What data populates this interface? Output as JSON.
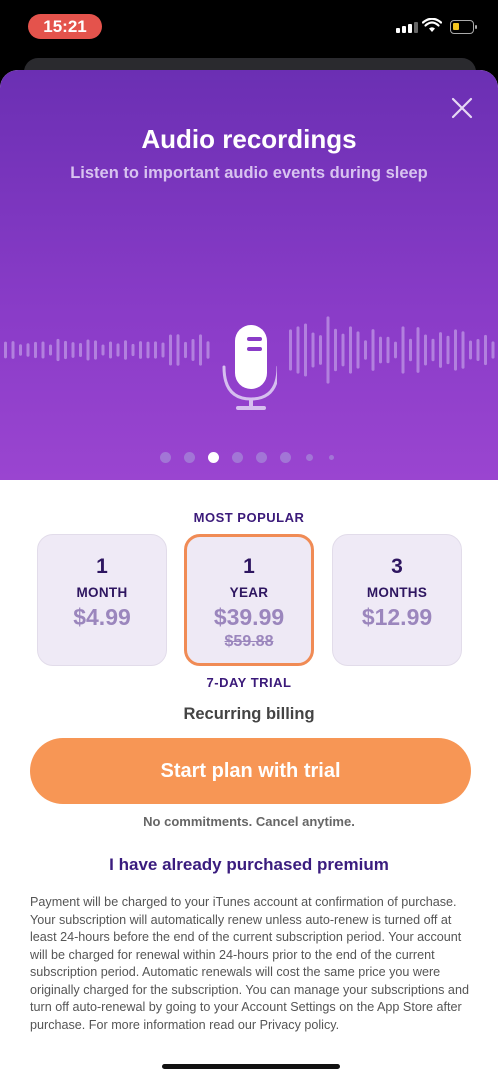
{
  "status_bar": {
    "time": "15:21"
  },
  "hero": {
    "title": "Audio recordings",
    "subtitle": "Listen to important audio events during sleep",
    "page_count": 8,
    "active_page": 2
  },
  "plans": {
    "badge": "MOST POPULAR",
    "options": [
      {
        "num": "1",
        "unit": "MONTH",
        "price": "$4.99",
        "old_price": ""
      },
      {
        "num": "1",
        "unit": "YEAR",
        "price": "$39.99",
        "old_price": "$59.88"
      },
      {
        "num": "3",
        "unit": "MONTHS",
        "price": "$12.99",
        "old_price": ""
      }
    ],
    "selected_index": 1,
    "trial_label": "7-DAY TRIAL"
  },
  "billing_label": "Recurring billing",
  "cta_label": "Start plan with trial",
  "no_commitments": "No commitments. Cancel anytime.",
  "restore_label": "I have already purchased premium",
  "legal_text": "Payment will be charged to your iTunes account at confirmation of purchase. Your subscription will automatically renew unless auto-renew is turned off at least 24-hours before the end of the current subscription period. Your account will be charged for renewal within 24-hours prior to the end of the current subscription period. Automatic renewals will cost the same price you were originally charged for the subscription. You can manage your subscriptions and turn off auto-renewal by going to your Account Settings on the App Store after purchase. For more information read our Privacy policy.",
  "colors": {
    "accent": "#f79655",
    "hero_purple": "#7a35bd",
    "text_dark": "#2e1660"
  }
}
